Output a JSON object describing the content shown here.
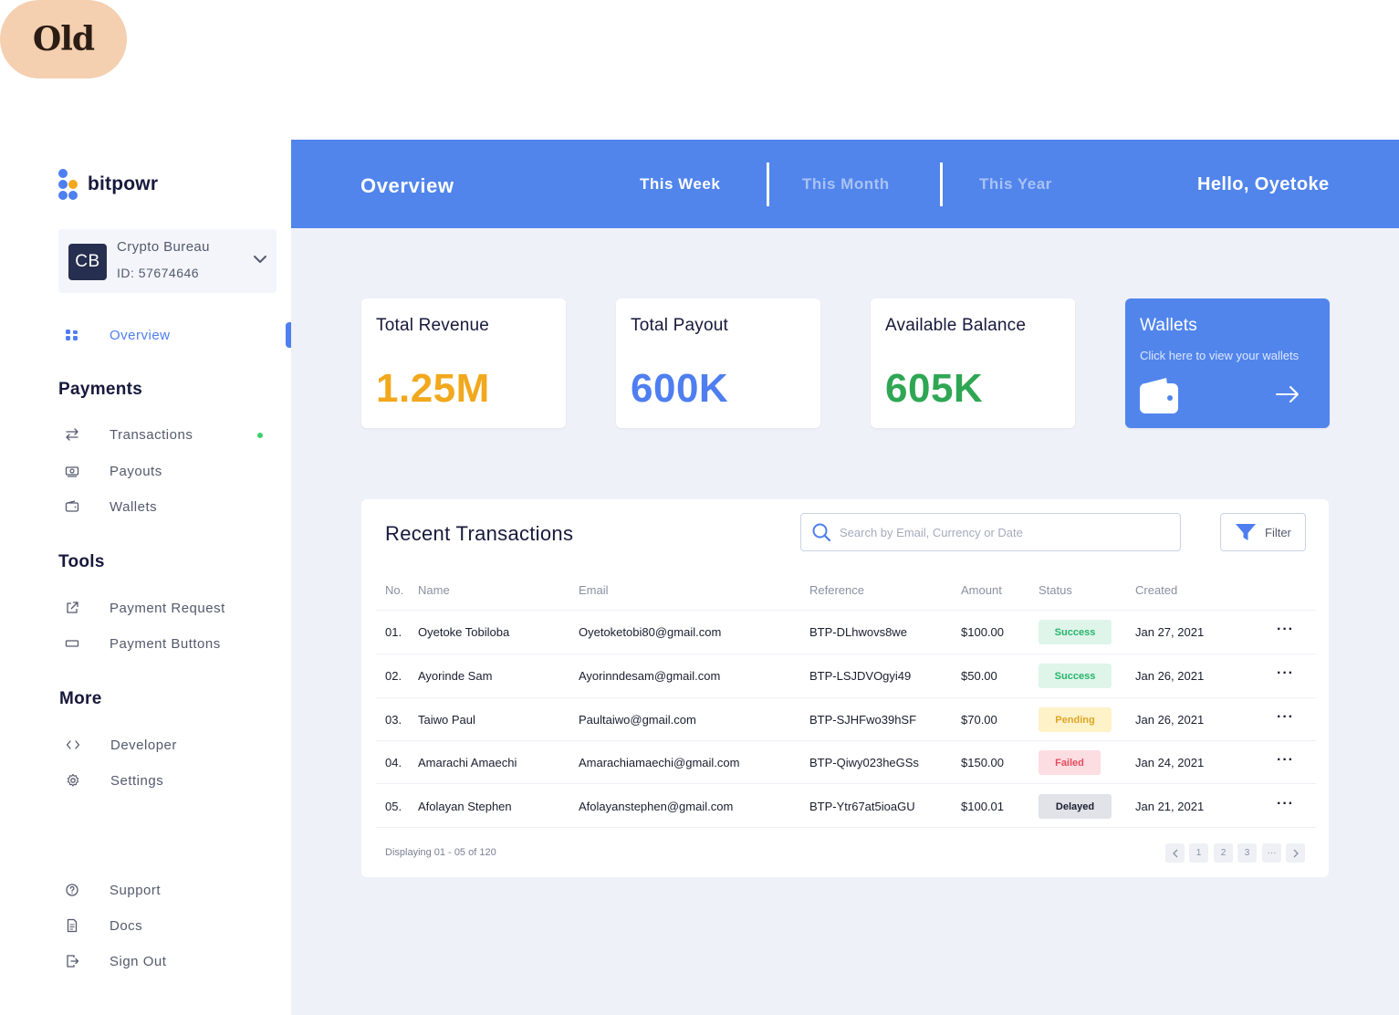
{
  "badge": {
    "label": "Old"
  },
  "brand": {
    "name": "bitpowr"
  },
  "account": {
    "initials": "CB",
    "name": "Crypto Bureau",
    "id": "ID: 57674646"
  },
  "sidebar": {
    "overview": "Overview",
    "payments_title": "Payments",
    "payments": [
      "Transactions",
      "Payouts",
      "Wallets"
    ],
    "tools_title": "Tools",
    "tools": [
      "Payment Request",
      "Payment Buttons"
    ],
    "more_title": "More",
    "more": [
      "Developer",
      "Settings"
    ],
    "bottom": [
      "Support",
      "Docs",
      "Sign Out"
    ]
  },
  "header": {
    "title": "Overview",
    "tabs": [
      "This Week",
      "This Month",
      "This Year"
    ],
    "active_tab": "This Week",
    "greeting": "Hello, Oyetoke"
  },
  "stats": [
    {
      "title": "Total Revenue",
      "value": "1.25M",
      "color": "#f2a81d"
    },
    {
      "title": "Total Payout",
      "value": "600K",
      "color": "#4e7ef0"
    },
    {
      "title": "Available Balance",
      "value": "605K",
      "color": "#2fa653"
    }
  ],
  "wallet_card": {
    "title": "Wallets",
    "subtitle": "Click here to view your wallets"
  },
  "transactions": {
    "title": "Recent Transactions",
    "search_placeholder": "Search by Email, Currency or Date",
    "filter_label": "Filter",
    "columns": [
      "No.",
      "Name",
      "Email",
      "Reference",
      "Amount",
      "Status",
      "Created"
    ],
    "rows": [
      {
        "no": "01.",
        "name": "Oyetoke Tobiloba",
        "email": "Oyetoketobi80@gmail.com",
        "ref": "BTP-DLhwovs8we",
        "amount": "$100.00",
        "status": "Success",
        "created": "Jan 27, 2021"
      },
      {
        "no": "02.",
        "name": "Ayorinde Sam",
        "email": "Ayorinndesam@gmail.com",
        "ref": "BTP-LSJDVOgyi49",
        "amount": "$50.00",
        "status": "Success",
        "created": "Jan 26, 2021"
      },
      {
        "no": "03.",
        "name": "Taiwo Paul",
        "email": "Paultaiwo@gmail.com",
        "ref": "BTP-SJHFwo39hSF",
        "amount": "$70.00",
        "status": "Pending",
        "created": "Jan 26, 2021"
      },
      {
        "no": "04.",
        "name": "Amarachi Amaechi",
        "email": "Amarachiamaechi@gmail.com",
        "ref": "BTP-Qiwy023heGSs",
        "amount": "$150.00",
        "status": "Failed",
        "created": "Jan 24, 2021"
      },
      {
        "no": "05.",
        "name": "Afolayan Stephen",
        "email": "Afolayanstephen@gmail.com",
        "ref": "BTP-Ytr67at5ioaGU",
        "amount": "$100.01",
        "status": "Delayed",
        "created": "Jan 21, 2021"
      }
    ],
    "row_menu": "···",
    "footer": "Displaying 01 - 05 of 120",
    "pages": [
      "1",
      "2",
      "3",
      "···"
    ]
  },
  "colors": {
    "primary": "#5185ec",
    "background": "#eef1f8",
    "sidebar_text": "#545a6d"
  },
  "icons": [
    "overview-icon",
    "transfer-icon",
    "payout-icon",
    "wallet-icon",
    "external-link-icon",
    "button-icon",
    "code-icon",
    "gear-icon",
    "help-icon",
    "document-icon",
    "sign-out-icon",
    "search-icon",
    "filter-icon",
    "arrow-right-icon"
  ]
}
